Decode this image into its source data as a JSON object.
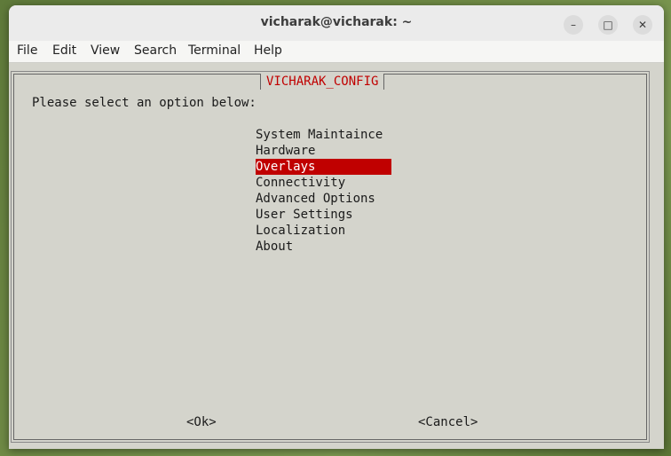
{
  "window": {
    "title": "vicharak@vicharak: ~",
    "controls": {
      "minimize": "–",
      "maximize": "□",
      "close": "✕"
    }
  },
  "menubar": [
    "File",
    "Edit",
    "View",
    "Search",
    "Terminal",
    "Help"
  ],
  "dialog": {
    "title": "VICHARAK_CONFIG",
    "prompt": "Please select an option below:",
    "options": [
      "System Maintaince",
      "Hardware",
      "Overlays",
      "Connectivity",
      "Advanced Options",
      "User Settings",
      "Localization",
      "About"
    ],
    "selected_index": 2,
    "ok_label": "<Ok>",
    "cancel_label": "<Cancel>"
  },
  "colors": {
    "selection": "#c00000",
    "dialog_bg": "#d4d4cc",
    "title_text": "#c00000"
  }
}
